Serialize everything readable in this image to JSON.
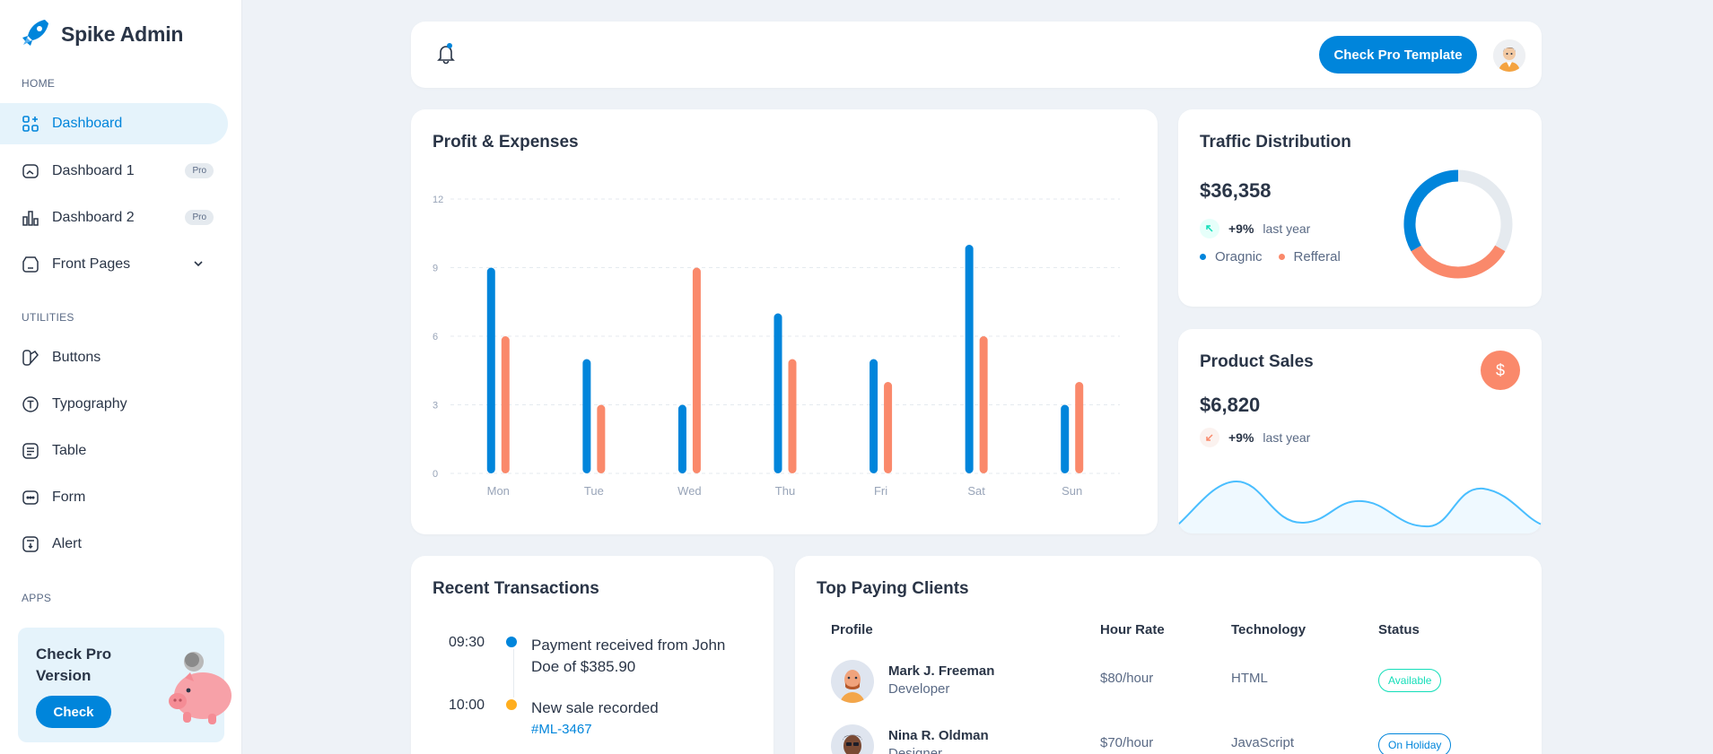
{
  "brand": {
    "name": "Spike Admin"
  },
  "sidebar": {
    "sections": [
      {
        "caption": "HOME"
      },
      {
        "caption": "UTILITIES"
      },
      {
        "caption": "APPS"
      }
    ],
    "items": [
      {
        "label": "Dashboard",
        "icon": "dashboard-icon",
        "active": true
      },
      {
        "label": "Dashboard 1",
        "icon": "message-icon",
        "badge": "Pro"
      },
      {
        "label": "Dashboard 2",
        "icon": "bar-chart-icon",
        "badge": "Pro"
      },
      {
        "label": "Front Pages",
        "icon": "app-window-icon"
      },
      {
        "label": "Buttons",
        "icon": "buttons-icon"
      },
      {
        "label": "Typography",
        "icon": "typography-icon"
      },
      {
        "label": "Table",
        "icon": "table-icon"
      },
      {
        "label": "Form",
        "icon": "form-icon"
      },
      {
        "label": "Alert",
        "icon": "alert-icon"
      }
    ],
    "promo": {
      "title": "Check Pro Version",
      "button": "Check"
    }
  },
  "header": {
    "cta": "Check Pro Template"
  },
  "profit": {
    "title": "Profit & Expenses",
    "chart_data": {
      "type": "bar",
      "categories": [
        "Mon",
        "Tue",
        "Wed",
        "Thu",
        "Fri",
        "Sat",
        "Sun"
      ],
      "series": [
        {
          "values": [
            9,
            5,
            3,
            7,
            5,
            10,
            3
          ],
          "color": "#0085db"
        },
        {
          "values": [
            6,
            3,
            9,
            5,
            4,
            6,
            4
          ],
          "color": "#fa896b"
        }
      ],
      "yticks": [
        0,
        3,
        6,
        9,
        12
      ],
      "ylim": [
        0,
        12
      ],
      "grid": true
    }
  },
  "traffic": {
    "title": "Traffic Distribution",
    "value": "$36,358",
    "trend": "+9%",
    "trend_label": "last year",
    "legend": [
      "Oragnic",
      "Refferal"
    ],
    "colors": {
      "organic": "#0085db",
      "referral": "#fa896b",
      "rest": "#e5eaef"
    }
  },
  "sales": {
    "title": "Product Sales",
    "value": "$6,820",
    "trend": "+9%",
    "trend_label": "last year",
    "badge": "$"
  },
  "recent": {
    "title": "Recent Transactions",
    "items": [
      {
        "time": "09:30",
        "text": "Payment received from John Doe of $385.90",
        "color": "#0085db"
      },
      {
        "time": "10:00",
        "text": "New sale recorded",
        "link": "#ML-3467",
        "color": "#ffae1f"
      }
    ]
  },
  "clients": {
    "title": "Top Paying Clients",
    "headers": [
      "Profile",
      "Hour Rate",
      "Technology",
      "Status"
    ],
    "rows": [
      {
        "name": "Mark J. Freeman",
        "role": "Developer",
        "rate": "$80/hour",
        "tech": "HTML",
        "status": "Available",
        "status_color": "#13deb9"
      },
      {
        "name": "Nina R. Oldman",
        "role": "Designer",
        "rate": "$70/hour",
        "tech": "JavaScript",
        "status": "On Holiday",
        "status_color": "#0085db"
      }
    ]
  }
}
